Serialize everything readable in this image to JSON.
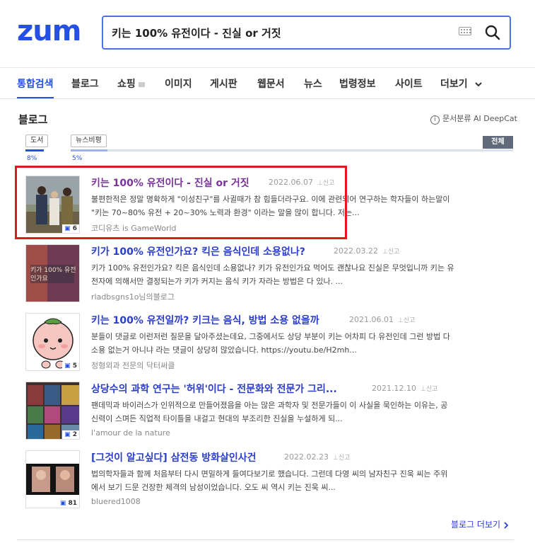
{
  "header": {
    "logo": "zum",
    "search_value": "키는 100% 유전이다 - 진실 or 거짓"
  },
  "tabs": [
    {
      "label": "통합검색",
      "active": true
    },
    {
      "label": "블로그"
    },
    {
      "label": "쇼핑"
    },
    {
      "label": "이미지"
    },
    {
      "label": "게시판"
    },
    {
      "label": "웹문서"
    },
    {
      "label": "뉴스"
    },
    {
      "label": "법령정보"
    },
    {
      "label": "사이트"
    },
    {
      "label": "더보기"
    }
  ],
  "section": {
    "title": "블로그",
    "deepcat": "문서분류 AI DeepCat",
    "filters": [
      {
        "label": "도서",
        "pct": "8%"
      },
      {
        "label": "뉴스비평",
        "pct": "5%"
      }
    ],
    "all_label": "전체"
  },
  "results": [
    {
      "title": "키는 100% 유전이다 - 진실 or 거짓",
      "date": "2022.06.07",
      "report": "신고",
      "desc1": "불편한적은 정말 명확하게 \"이성친구\"를 사귈때가 참 힘들더라구요. 이에 관련되어 연구하는 학자들이 하는말이",
      "desc2": "\"키는 70~80% 유전 + 20~30% 노력과 환경\" 이라는 말을 많이 합니다. 저는...",
      "source": "코디유츠 is GameWorld",
      "count": "6"
    },
    {
      "title": "키가 100% 유전인가요? 킥은 음식인데 소용없나?",
      "date": "2022.03.22",
      "report": "신고",
      "desc1": "키가 100% 유전인가요? 킥은 음식인데 소용없나? 키가 유전인가요 먹어도 괜찮나요 진실은 무엇입니까 키는 유",
      "desc2": "전자에 의해서만 결정되는가 키가 커지는 음식 키가 자라는 방법은 다 있나. ...",
      "source": "rladbsgns1o님의블로그",
      "thumb_text": "키가 100% 유전인가요"
    },
    {
      "title": "키는 100% 유전일까? 키크는 음식, 방법 소용 없을까",
      "date": "2021.06.01",
      "report": "신고",
      "desc1": "분들이 댓글로 이런저런 질문을 달아주셨는데요, 그중에서도 상당 부분이 키는 어차피 다 유전인데 그런 방법 다",
      "desc2": "소용 없는거 아니냐 라는 댓글이 상당히 많았습니다. https://youtu.be/H2mh...",
      "source": "정형외과 전문의 닥터써클",
      "count": "5"
    },
    {
      "title": "상당수의 과학 연구는 '허위'이다 - 전문화와 전문가 그리...",
      "date": "2021.12.10",
      "report": "신고",
      "desc1": "팬데믹과 바이러스가 인위적으로 만들어졌음을 아는 많은 과학자 및 전문가들이 이 사실을 묵인하는 이유는, 공",
      "desc2": "신력이 스며든 직업적 타이틀을 내걸고 현대의 부조리한 진실을 누설하게 되...",
      "source": "l'amour de la nature",
      "count": "2"
    },
    {
      "title": "[그것이 알고싶다] 삼전동 방화살인사건",
      "date": "2022.02.23",
      "report": "신고",
      "desc1": "법의학자들과 함께 처음부터 다시 면밀하게 들여다보기로 했습니다. 그런데 다영 씨의 남자친구 진욱 씨는 주위",
      "desc2": "에서 보기 드문 건장한 체격의 남성이었습니다. 오도 씨 역시 키는 진욱 씨...",
      "source": "bluered1008",
      "count": "81"
    }
  ],
  "more_label": "블로그 더보기"
}
